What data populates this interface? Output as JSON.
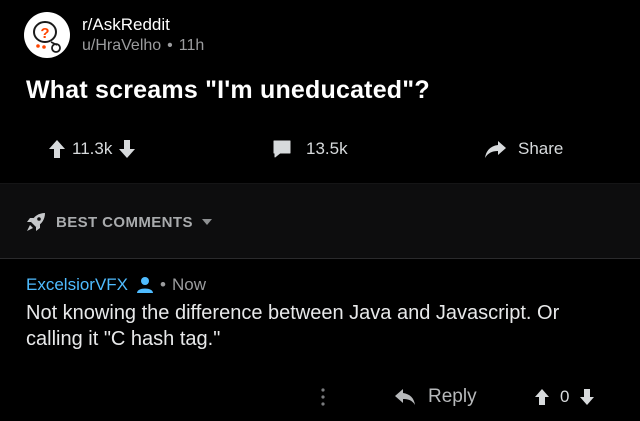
{
  "post": {
    "subreddit": "r/AskReddit",
    "author": "u/HraVelho",
    "separator": "•",
    "age": "11h",
    "title": "What screams \"I'm uneducated\"?",
    "upvotes": "11.3k",
    "comments": "13.5k",
    "share_label": "Share"
  },
  "sort": {
    "label": "BEST COMMENTS"
  },
  "comment": {
    "author": "ExcelsiorVFX",
    "separator": "•",
    "time": "Now",
    "body": "Not knowing the difference between Java and Javascript. Or calling it \"C hash tag.\"",
    "reply_label": "Reply",
    "score": "0"
  },
  "colors": {
    "background": "#000000",
    "accent_username": "#4fbcff",
    "muted_text": "#9b9c9e",
    "sort_bar": "#0d0d0e"
  },
  "icons": {
    "subreddit": "askreddit-snoo-icon",
    "upvote": "arrow-up-icon",
    "downvote": "arrow-down-icon",
    "comment": "speech-bubble-icon",
    "share": "share-arrow-icon",
    "sort": "rocket-icon",
    "dropdown": "caret-down-icon",
    "user": "person-icon",
    "more": "vertical-dots-icon",
    "reply": "reply-arrow-icon"
  }
}
